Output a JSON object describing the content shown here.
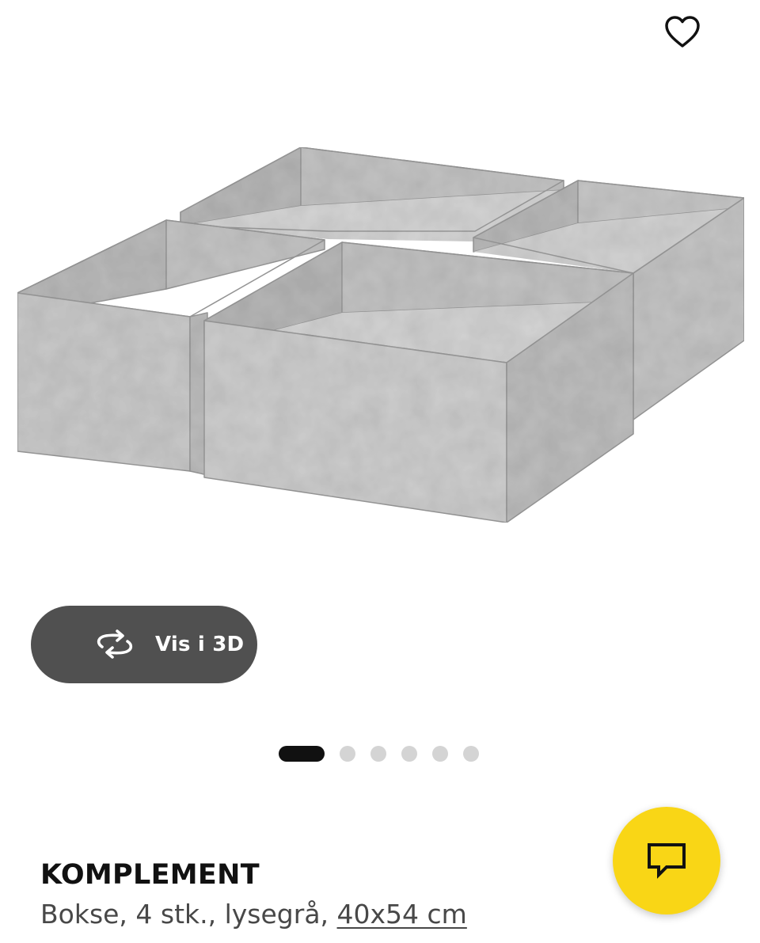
{
  "favorite": {
    "icon": "heart-outline-icon"
  },
  "gallery": {
    "image_alt": "KOMPLEMENT",
    "view_3d_label": "Vis i 3D",
    "view_3d_icon": "rotate-3d-icon",
    "page_count": 6,
    "current_page": 1
  },
  "chat": {
    "icon": "chat-bubble-icon",
    "color": "#f9d616"
  },
  "product": {
    "name": "KOMPLEMENT",
    "description": "Bokse, 4 stk., lysegrå, ",
    "size": "40x54 cm"
  },
  "colors": {
    "felt": "#c9c9c9",
    "view_3d_bg": "#505050",
    "pager_active": "#111111",
    "pager_inactive": "#d4d4d4"
  }
}
